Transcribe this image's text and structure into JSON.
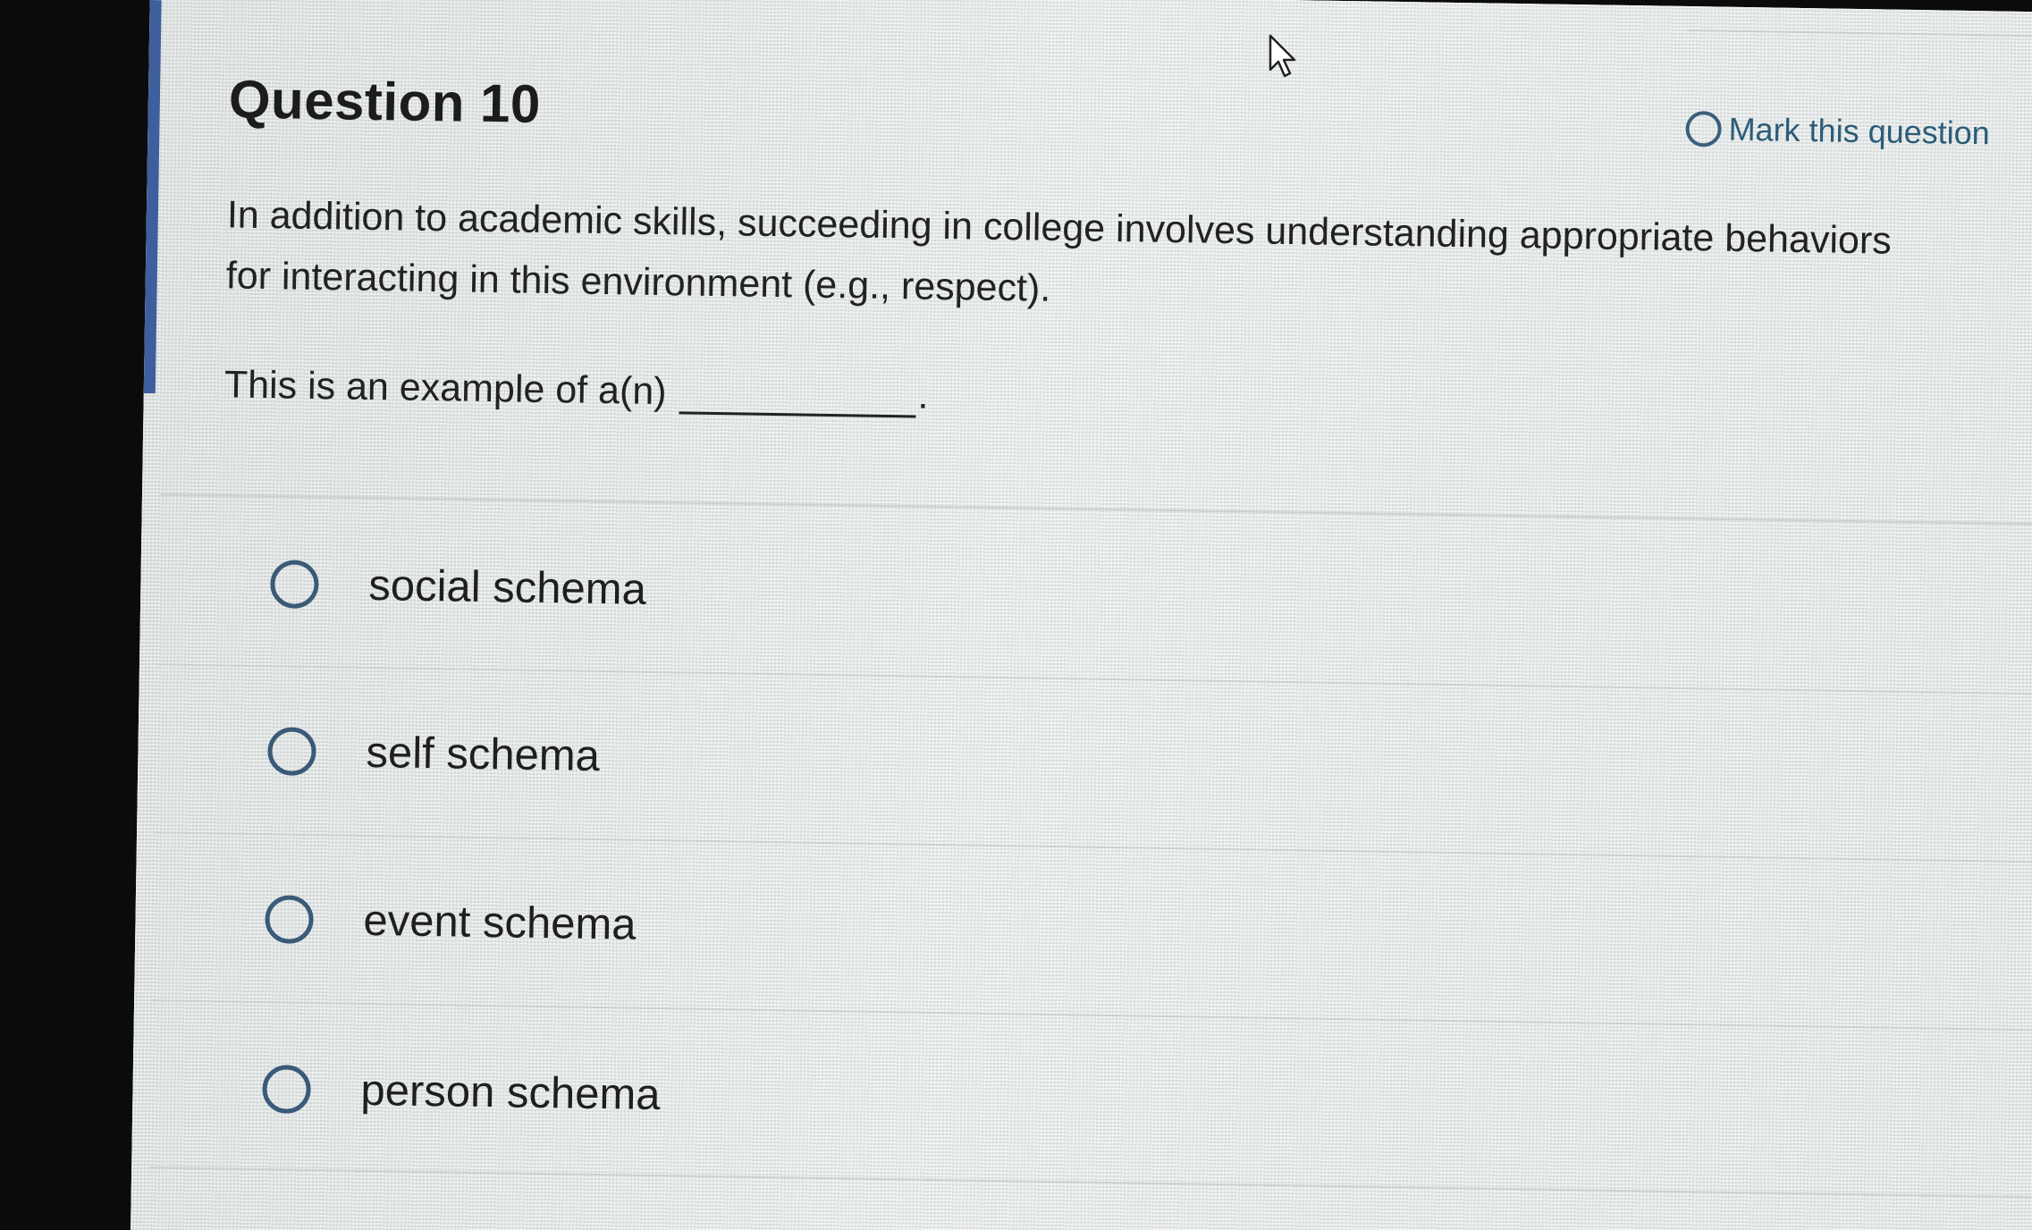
{
  "question": {
    "title": "Question 10",
    "mark_label": "Mark this question",
    "body": "In addition to academic skills, succeeding in college involves understanding appropriate behaviors for interacting in this environment (e.g., respect).",
    "prompt": "This is an example of a(n)",
    "prompt_end": "."
  },
  "options": [
    {
      "label": "social schema"
    },
    {
      "label": "self schema"
    },
    {
      "label": "event schema"
    },
    {
      "label": "person schema"
    }
  ],
  "icons": {
    "mark": "radio-circle-icon",
    "option": "radio-circle-icon",
    "cursor": "mouse-pointer-icon"
  },
  "colors": {
    "accent": "#3f5f9c",
    "link": "#2b5c78",
    "radio_border": "#3a5a78"
  }
}
